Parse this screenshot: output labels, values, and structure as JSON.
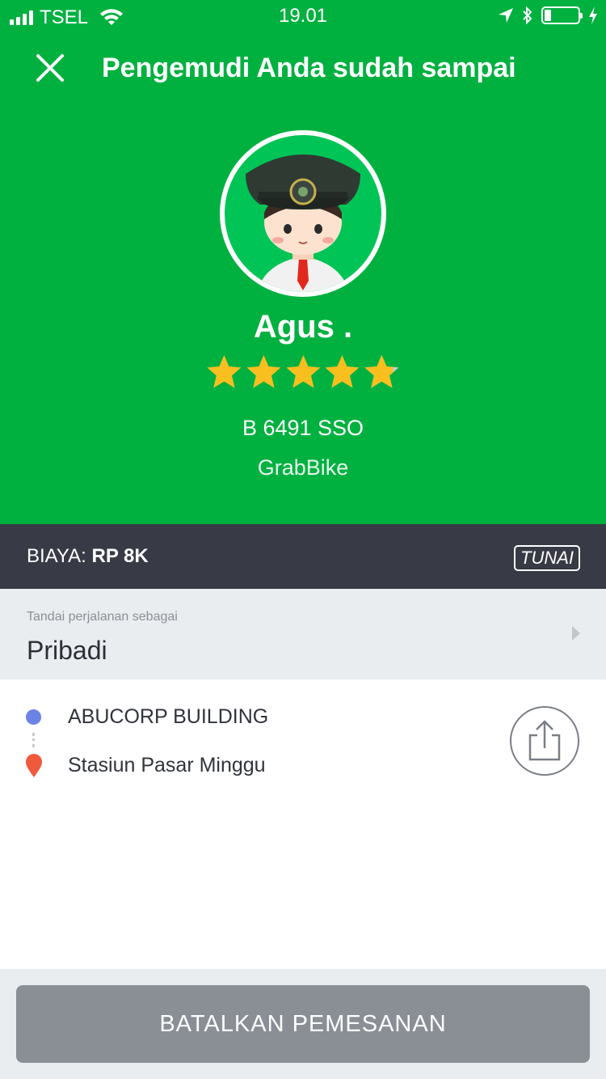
{
  "status_bar": {
    "carrier": "TSEL",
    "time": "19.01",
    "battery_level": 0.2
  },
  "header": {
    "title": "Pengemudi Anda sudah sampai",
    "close_icon": "close-icon"
  },
  "driver": {
    "name": "Agus .",
    "rating": 4.8,
    "max_rating": 5,
    "plate": "B 6491 SSO",
    "vehicle": "GrabBike"
  },
  "fare": {
    "label": "BIAYA: ",
    "amount": "RP 8K",
    "payment_method": "TUNAI"
  },
  "trip_tag": {
    "caption": "Tandai perjalanan sebagai",
    "value": "Pribadi"
  },
  "route": {
    "pickup": "ABUCORP BUILDING",
    "dropoff": "Stasiun Pasar Minggu",
    "share_icon": "share-icon"
  },
  "footer": {
    "cancel_label": "BATALKAN PEMESANAN"
  },
  "colors": {
    "brand_green": "#00b140",
    "fare_bar": "#383b45",
    "star": "#f9bf1f",
    "pickup": "#6b83e4",
    "dropoff": "#f05a3c",
    "cancel_button": "#8a8e95"
  }
}
